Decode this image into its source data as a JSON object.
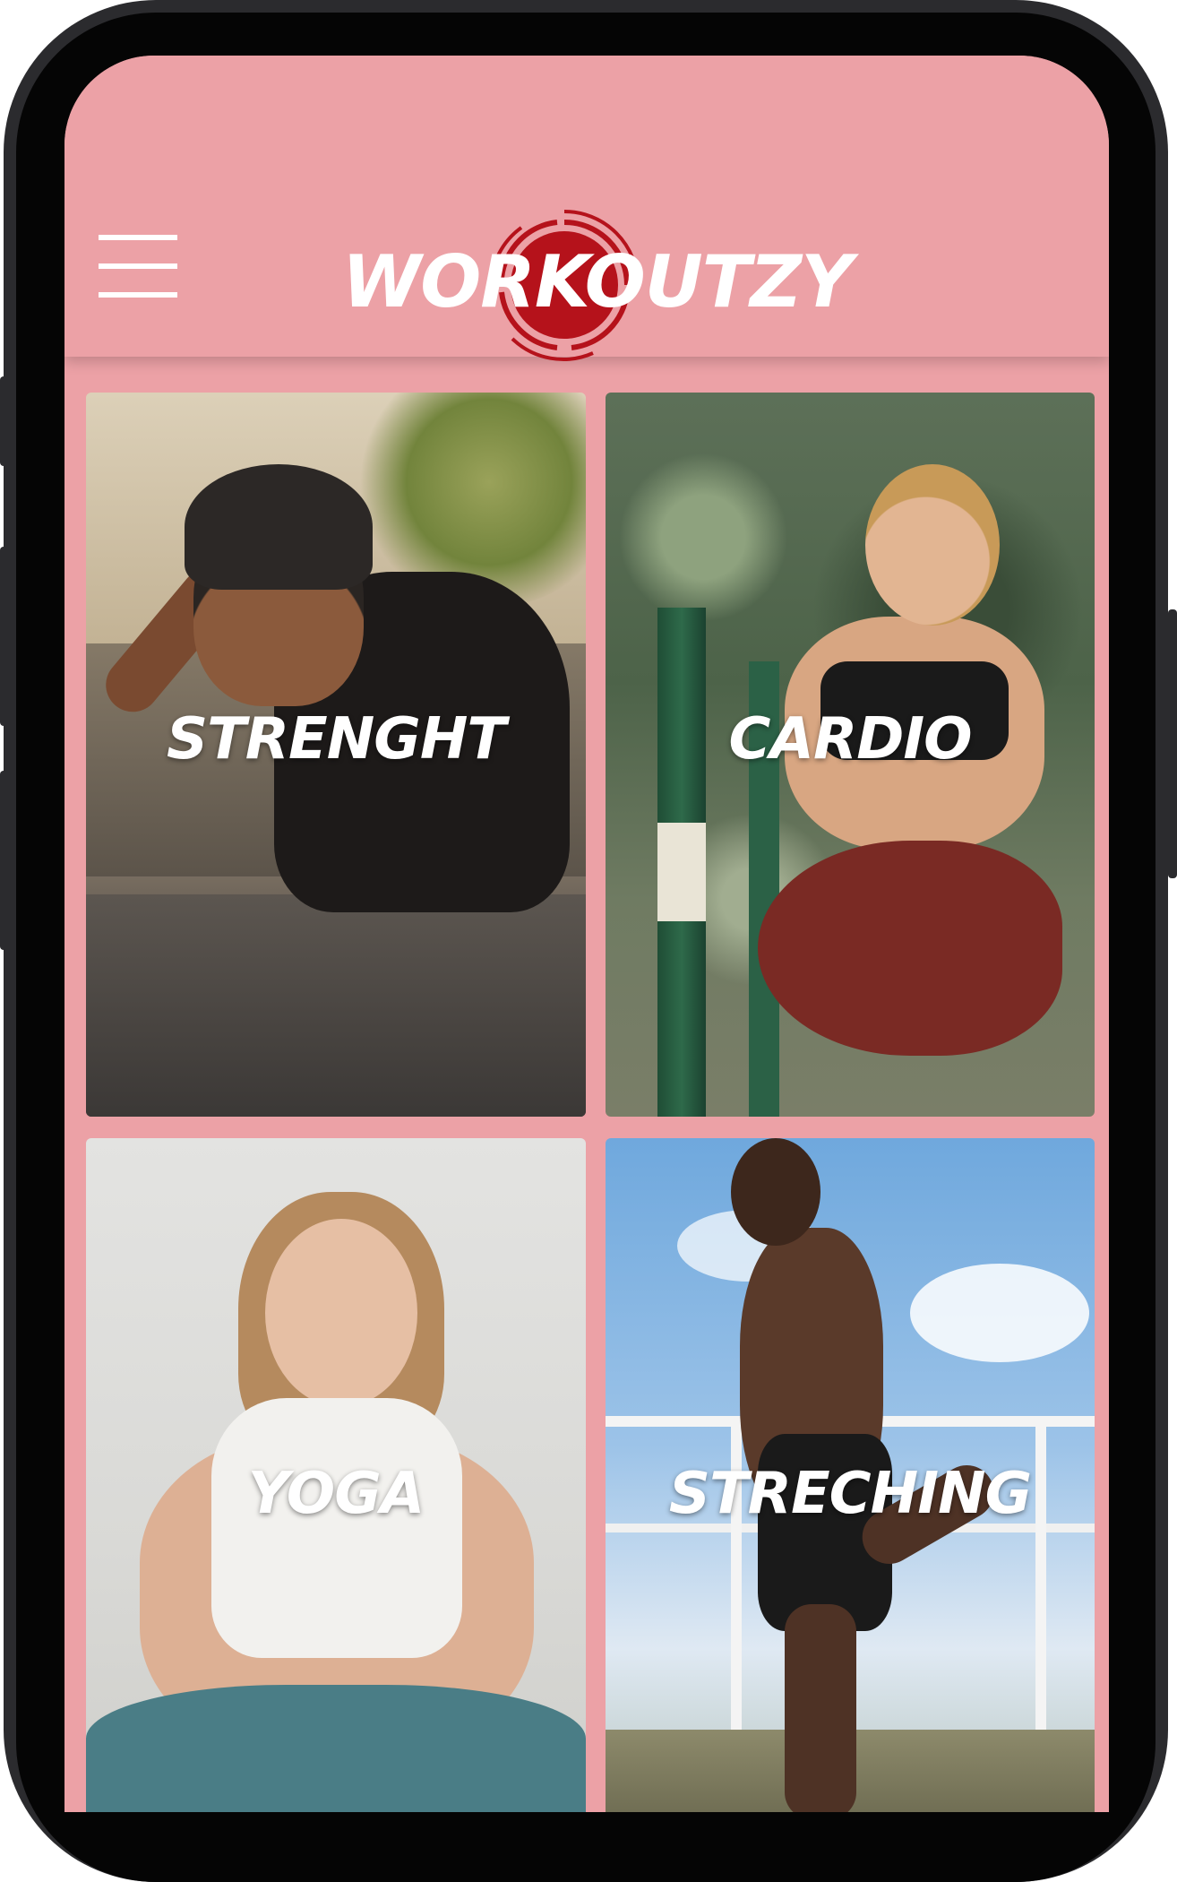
{
  "app": {
    "title": "WORKOUTZY"
  },
  "header": {
    "menu_icon": "hamburger-menu-icon",
    "logo_icon": "red-circle-logo-icon",
    "colors": {
      "background": "#eca1a6",
      "logo_red": "#b5121b",
      "text": "#ffffff"
    }
  },
  "categories": [
    {
      "label": "STRENGHT"
    },
    {
      "label": "CARDIO"
    },
    {
      "label": "YOGA"
    },
    {
      "label": "STRECHING"
    }
  ]
}
